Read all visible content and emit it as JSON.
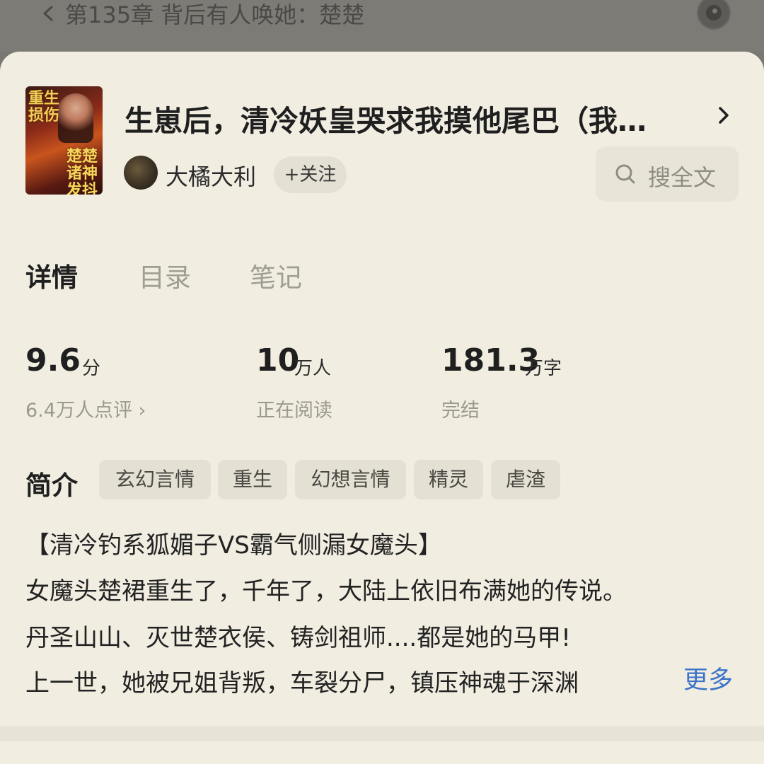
{
  "header": {
    "chapter_title": "第135章 背后有人唤她：楚楚"
  },
  "book": {
    "title": "生崽后，清冷妖皇哭求我摸他尾巴（我…",
    "cover_text_top": "重生损伤",
    "cover_text_bottom": "楚楚诸神发抖",
    "author": "大橘大利",
    "follow_label": "+关注"
  },
  "search": {
    "label": "搜全文"
  },
  "tabs": [
    {
      "label": "详情",
      "active": true
    },
    {
      "label": "目录",
      "active": false
    },
    {
      "label": "笔记",
      "active": false
    }
  ],
  "stats": [
    {
      "value": "9.6",
      "unit": "分",
      "label": "6.4万人点评 ›"
    },
    {
      "value": "10",
      "unit": "万人",
      "label": "正在阅读"
    },
    {
      "value": "181.3",
      "unit": "万字",
      "label": "完结"
    }
  ],
  "intro": {
    "heading": "简介",
    "tags": [
      "玄幻言情",
      "重生",
      "幻想言情",
      "精灵",
      "虐渣"
    ],
    "lines": [
      "【清冷钓系狐媚子VS霸气侧漏女魔头】",
      "女魔头楚裙重生了，千年了，大陆上依旧布满她的传说。",
      "丹圣山山、灭世楚衣侯、铸剑祖师....都是她的马甲!",
      "上一世，她被兄姐背叛，车裂分尸，镇压神魂于深渊"
    ],
    "more_label": "更多"
  },
  "colors": {
    "accent_link": "#3b73c8",
    "sheet_bg": "#f1ede1",
    "tag_bg": "#e4e0d4"
  }
}
